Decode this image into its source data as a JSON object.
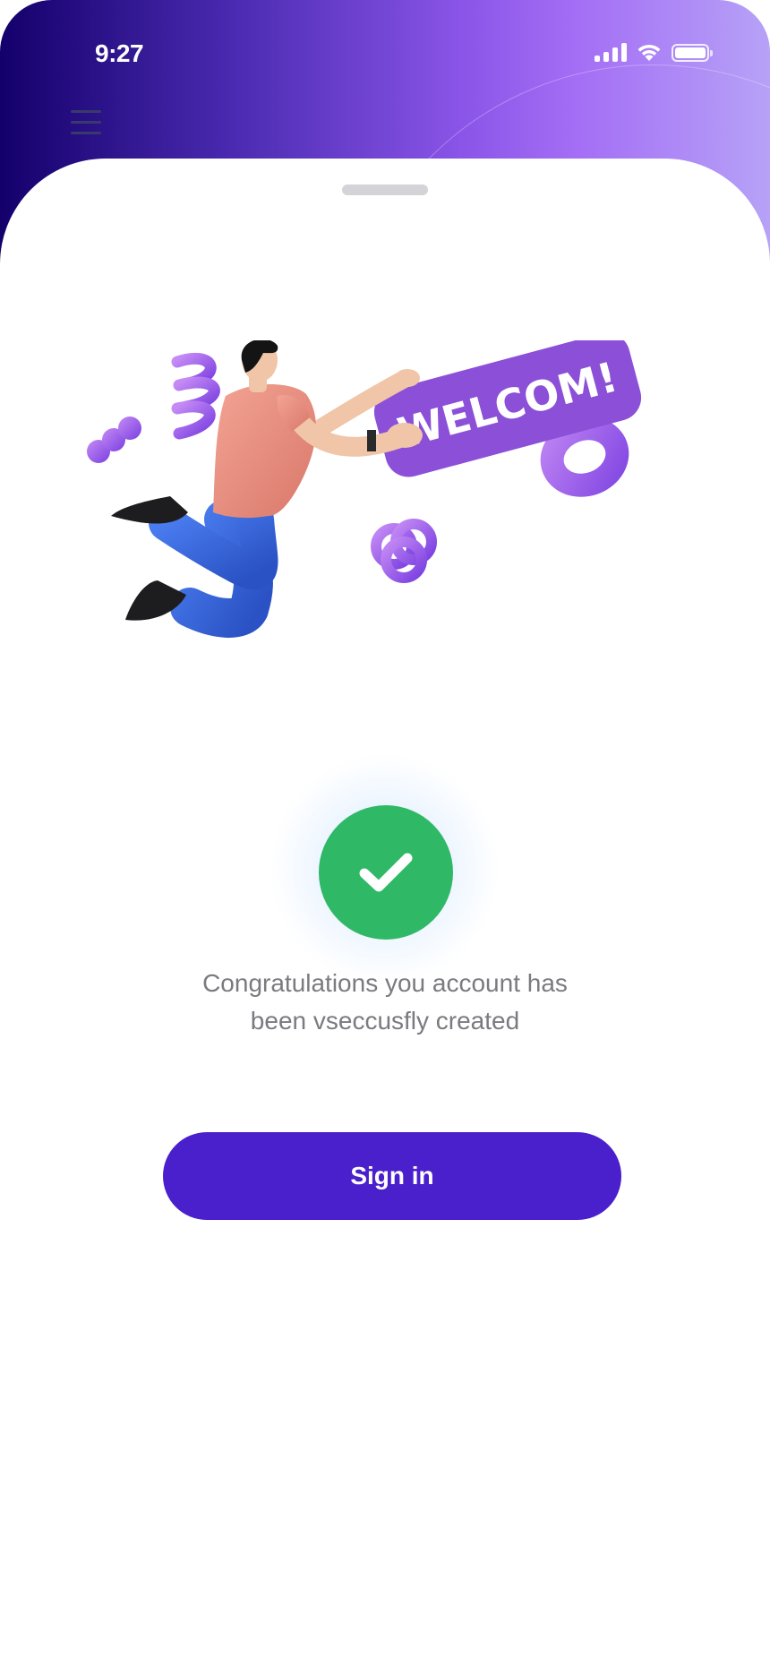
{
  "status_bar": {
    "time": "9:27",
    "icons": [
      "cellular-signal-icon",
      "wifi-icon",
      "battery-icon"
    ]
  },
  "header": {
    "menu_icon": "hamburger-menu-icon",
    "gradient_colors": [
      "#14006b",
      "#8a55e8",
      "#b6a2f7"
    ]
  },
  "illustration": {
    "sign_text": "WELCOM!",
    "sign_color": "#8b4fd8"
  },
  "success": {
    "icon": "checkmark-icon",
    "color": "#2fb865",
    "message_line1": "Congratulations you account has",
    "message_line2": "been vseccusfly created"
  },
  "actions": {
    "signin_label": "Sign in",
    "signin_color": "#4a1fcc"
  }
}
